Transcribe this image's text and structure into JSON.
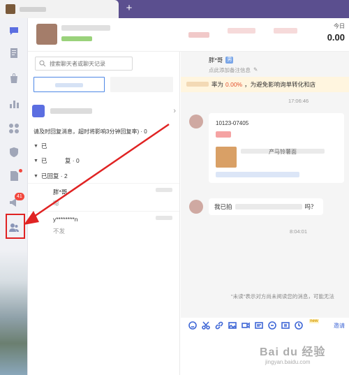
{
  "topbar": {
    "add_label": "+"
  },
  "rail": {
    "icons": [
      "chat-icon",
      "document-icon",
      "bag-icon",
      "bar-chart-icon",
      "grid-icon",
      "shield-icon",
      "file-alert-icon",
      "megaphone-icon",
      "contacts-icon"
    ],
    "badge": "41"
  },
  "header": {
    "today_label": "今日",
    "today_value": "0.00"
  },
  "search": {
    "placeholder": "搜索聊天者或聊天记录"
  },
  "list": {
    "warning": "请及时回复消息，超时将影响3分钟回复率) · 0",
    "groups": [
      {
        "label": "已",
        "count": ""
      },
      {
        "label": "已　　　复 · 0",
        "count": ""
      },
      {
        "label": "已回复 · 2",
        "count": ""
      }
    ],
    "conversations": [
      {
        "name": "胖*哥",
        "preview": "嗯"
      },
      {
        "name": "y********n",
        "preview": "不发"
      }
    ]
  },
  "chat": {
    "customer_name": "胖*哥",
    "customer_tag": "男",
    "customer_note": "点此添加备注信息",
    "alert_prefix": "率为",
    "alert_pct": "0.00%",
    "alert_suffix": "，为避免影响询单转化和店",
    "time1": "17:06:46",
    "order_id": "10123-07405",
    "product_suffix": "产马铃薯面",
    "bubble_prefix": "我已拍",
    "bubble_suffix": "吗？",
    "time2": "8:04:01",
    "unread_hint": "\"未读\"表示对方尚未阅读您的消息，可能无法",
    "quick_reply": "邀请",
    "new_badge": "new"
  },
  "watermark": {
    "main": "Bai du 经验",
    "sub": "jingyan.baidu.com"
  },
  "colors": {
    "accent": "#5b6ee1",
    "alert": "#e2502d",
    "highlight": "#e02323"
  }
}
